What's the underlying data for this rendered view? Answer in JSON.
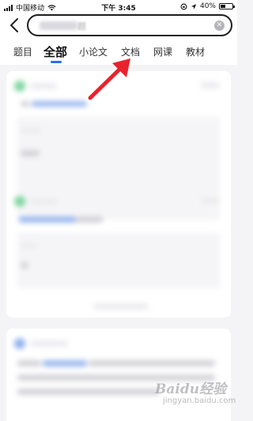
{
  "status_bar": {
    "carrier": "中国移动",
    "time": "下午 3:45",
    "battery": "40%",
    "battery_level": 0.4
  },
  "header": {
    "back_icon": "chevron-left-icon",
    "search": {
      "value_suffix": "题",
      "clear_icon": "clear-circle-icon"
    }
  },
  "tabs": [
    {
      "label": "题目",
      "active": false
    },
    {
      "label": "全部",
      "active": true
    },
    {
      "label": "小论文",
      "active": false
    },
    {
      "label": "文档",
      "active": false
    },
    {
      "label": "网课",
      "active": false
    },
    {
      "label": "教材",
      "active": false
    }
  ],
  "annotation": {
    "arrow_color": "#e8232d"
  },
  "watermark": {
    "logo": "Baidu经验",
    "url": "jingyan.baidu.com"
  },
  "colors": {
    "accent": "#2b6ef2"
  }
}
